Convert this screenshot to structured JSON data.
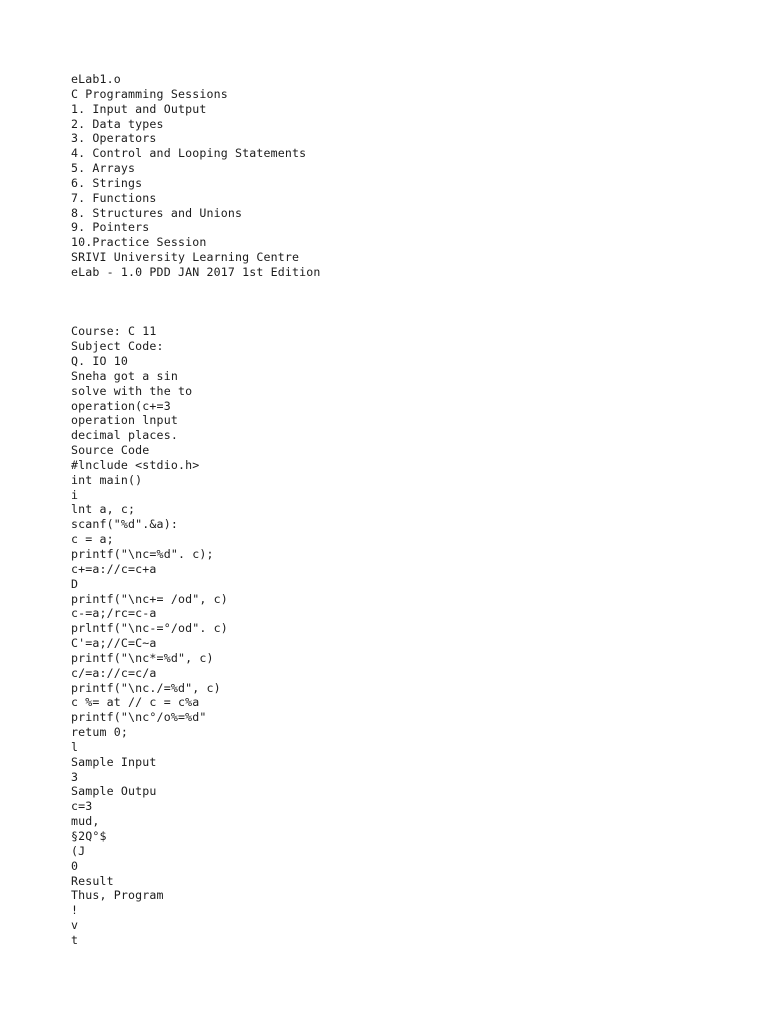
{
  "document": {
    "title": "eLab1.o",
    "background_color": "#ffffff",
    "text_color": "#1c1c1c"
  },
  "cover_block": {
    "lines": [
      "eLab1.o",
      "C Programming Sessions",
      "1. Input and Output",
      "2. Data types",
      "3. Operators",
      "4. Control and Looping Statements",
      "5. Arrays",
      "6. Strings",
      "7. Functions",
      "8. Structures and Unions",
      "9. Pointers",
      "10.Practice Session",
      "SRIVI University Learning Centre",
      "eLab - 1.0 PDD JAN 2017 1st Edition"
    ]
  },
  "body_block": {
    "lines": [
      "Course: C 11",
      "Subject Code:",
      "Q. IO 10",
      "Sneha got a sin",
      "solve with the to",
      "operation(c+=3",
      "operation lnput",
      "decimal places.",
      "Source Code",
      "#lnclude <stdio.h>",
      "int main()",
      "i",
      "lnt a, c;",
      "scanf(\"%d\".&a):",
      "c = a;",
      "printf(\"\\nc=%d\". c);",
      "c+=a://c=c+a",
      "D",
      "printf(\"\\nc+= /od\", c)",
      "c-=a;/rc=c-a",
      "prlntf(\"\\nc-=°/od\". c)",
      "C'=a;//C=C~a",
      "printf(\"\\nc*=%d\", c)",
      "c/=a://c=c/a",
      "printf(\"\\nc./=%d\", c)",
      "c %= at // c = c%a",
      "printf(\"\\nc°/o%=%d\"",
      "retum 0;",
      "l",
      "Sample Input",
      "3",
      "Sample Outpu",
      "c=3",
      "mud,",
      "§2Q°$",
      "(J",
      "0",
      "Result",
      "Thus, Program",
      "!",
      "v",
      "t"
    ]
  }
}
